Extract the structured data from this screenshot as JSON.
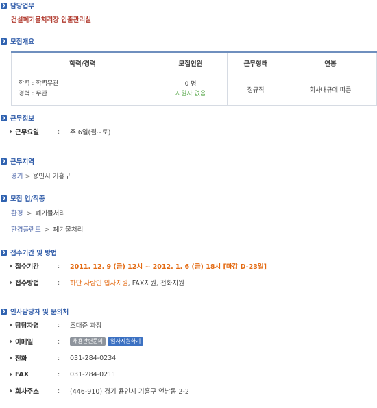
{
  "duty": {
    "section_title": "담당업무",
    "text": "건설폐기물처리장 입출관리실"
  },
  "recruit": {
    "section_title": "모집개요",
    "headers": [
      "학력/경력",
      "모집인원",
      "근무형태",
      "연봉"
    ],
    "education": "학력 : 학력무관",
    "career": "경력 : 무관",
    "headcount": "0 명",
    "applicants": "지원자 없음",
    "work_type": "정규직",
    "salary": "회사내규에 따름"
  },
  "work_info": {
    "section_title": "근무정보",
    "label": "근무요일",
    "value": "주 6일(월~토)"
  },
  "region": {
    "section_title": "근무지역",
    "province": "경기",
    "city": "용인시 기흥구"
  },
  "job": {
    "section_title": "모집 업/직종",
    "row1_parent": "환경",
    "row1_child": "폐기물처리",
    "row2_parent": "환경플랜트",
    "row2_child": "폐기물처리"
  },
  "apply": {
    "section_title": "접수기간 및 방법",
    "period_label": "접수기간",
    "period_value": "2011. 12. 9 (금) 12시 ~ 2012. 1. 6 (금) 18시 [마감 D-23일]",
    "method_label": "접수방법",
    "method_link": "하단 사람인 입사지원",
    "method_rest": ", FAX지원, 전화지원"
  },
  "contact": {
    "section_title": "인사담당자 및 문의처",
    "manager_label": "담당자명",
    "manager_value": "조대준 과장",
    "email_label": "이메일",
    "email_btn1": "채용관련문의",
    "email_btn2": "입사지원하기",
    "phone_label": "전화",
    "phone_value": "031-284-0234",
    "fax_label": "FAX",
    "fax_value": "031-284-0211",
    "address_label": "회사주소",
    "address_value": "(446-910) 경기 용인시 기흥구 언남동 2-2"
  },
  "colon": ":"
}
